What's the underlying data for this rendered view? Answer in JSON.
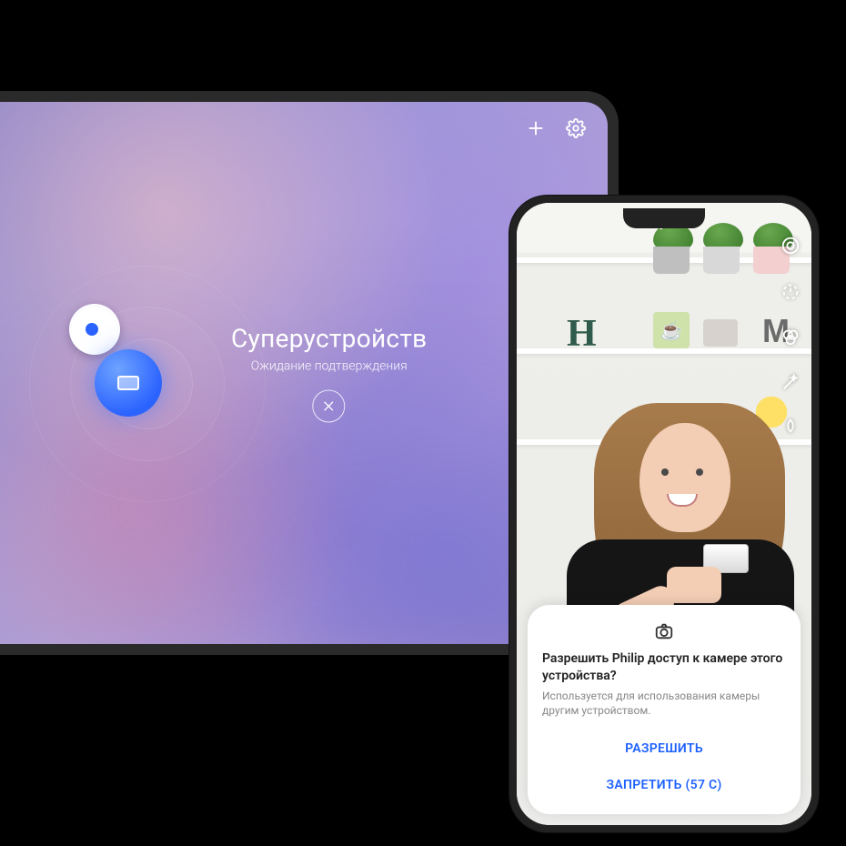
{
  "tablet": {
    "title": "Суперустройств",
    "subtitle": "Ожидание подтверждения",
    "icons": {
      "plus": "add-icon",
      "settings": "gear-icon",
      "close": "close-icon"
    },
    "nodes": {
      "phone": "phone-node",
      "tablet": "tablet-node"
    }
  },
  "phone": {
    "camera_icons": {
      "music": "music-icon",
      "lens": "lens-switch-icon",
      "timer": "timer-icon",
      "filter": "filter-icon",
      "wand": "beauty-icon",
      "leaf": "effect-icon"
    },
    "scene": {
      "letter_h": "H",
      "letter_m": "M",
      "mug_emoji": "☕"
    },
    "permission": {
      "title": "Разрешить Philip доступ к камере этого устройства?",
      "subtitle": "Используется для использования камеры другим устройством.",
      "allow": "РАЗРЕШИТЬ",
      "deny": "ЗАПРЕТИТЬ (57 С)"
    }
  }
}
